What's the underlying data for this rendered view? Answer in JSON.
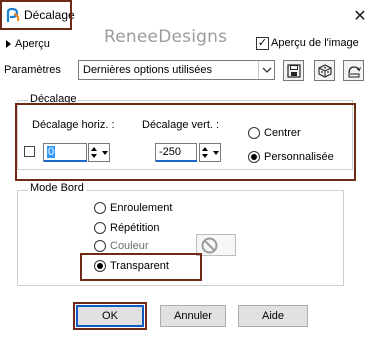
{
  "window": {
    "title": "Décalage",
    "close_glyph": "✕",
    "icon": "paintshop-app-icon"
  },
  "preview": {
    "toggle_label": "Aperçu",
    "watermark": "ReneeDesigns",
    "checkbox_label": "Aperçu de l'image",
    "checkbox_checked": true,
    "check_glyph": "✓"
  },
  "params": {
    "label": "Paramètres",
    "selected": "Dernières options utilisées",
    "buttons": [
      "save-preset-icon",
      "cube-icon",
      "reset-icon"
    ]
  },
  "offset": {
    "group_title": "Décalage",
    "horiz_label": "Décalage horiz. :",
    "horiz_value": "0",
    "vert_label": "Décalage vert. :",
    "vert_value": "-250",
    "link_checked": false,
    "options": [
      {
        "label": "Centrer",
        "selected": false
      },
      {
        "label": "Personnalisée",
        "selected": true
      }
    ]
  },
  "edge_mode": {
    "group_title": "Mode Bord",
    "options": [
      {
        "label": "Enroulement",
        "selected": false
      },
      {
        "label": "Répétition",
        "selected": false
      },
      {
        "label": "Couleur",
        "selected": false
      },
      {
        "label": "Transparent",
        "selected": true
      }
    ]
  },
  "footer": {
    "ok": "OK",
    "cancel": "Annuler",
    "help": "Aide"
  },
  "colors": {
    "highlight_frame": "#6e2a14",
    "focus_blue": "#0a5bc4",
    "selection_blue": "#3399ff"
  }
}
